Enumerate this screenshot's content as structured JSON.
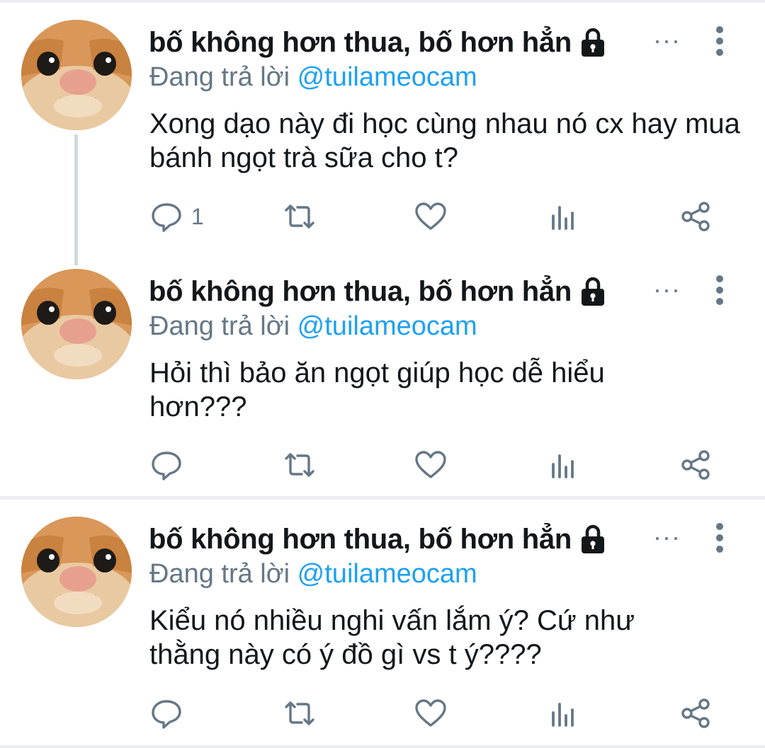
{
  "tweets": [
    {
      "author": "bố không hơn thua, bố hơn hẳn",
      "reply_prefix": "Đang trả lời ",
      "reply_handle": "@tuilameocam",
      "text": "Xong dạo này đi học cùng nhau nó cx hay mua bánh ngọt trà sữa cho t?",
      "reply_count": "1"
    },
    {
      "author": "bố không hơn thua, bố hơn hẳn",
      "reply_prefix": "Đang trả lời ",
      "reply_handle": "@tuilameocam",
      "text": "Hỏi thì bảo ăn ngọt giúp học dễ hiểu hơn???",
      "reply_count": ""
    },
    {
      "author": "bố không hơn thua, bố hơn hẳn",
      "reply_prefix": "Đang trả lời ",
      "reply_handle": "@tuilameocam",
      "text": "Kiểu nó nhiều nghi vấn lắm ý? Cứ như thằng này có ý đồ gì vs t ý????",
      "reply_count": ""
    }
  ],
  "ellipsis": "···",
  "icons": [
    "lock-icon",
    "more-icon",
    "reply-icon",
    "retweet-icon",
    "like-icon",
    "analytics-icon",
    "share-icon"
  ],
  "colors": {
    "text": "#14171a",
    "muted": "#657786",
    "link": "#1da1f2",
    "divider": "#eceff1"
  }
}
